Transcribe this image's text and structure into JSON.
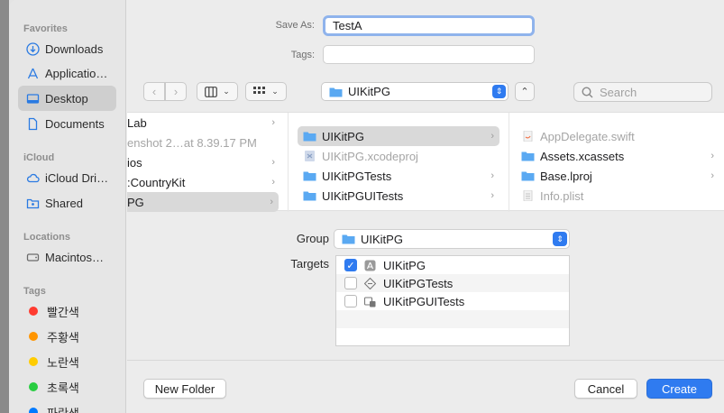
{
  "sidebar": {
    "favorites_title": "Favorites",
    "favorites": [
      {
        "label": "Downloads",
        "icon": "download-icon"
      },
      {
        "label": "Applicatio…",
        "icon": "applications-icon"
      },
      {
        "label": "Desktop",
        "icon": "desktop-icon",
        "selected": true
      },
      {
        "label": "Documents",
        "icon": "document-icon"
      }
    ],
    "icloud_title": "iCloud",
    "icloud": [
      {
        "label": "iCloud Dri…",
        "icon": "cloud-icon"
      },
      {
        "label": "Shared",
        "icon": "shared-folder-icon"
      }
    ],
    "locations_title": "Locations",
    "locations": [
      {
        "label": "Macintos…",
        "icon": "disk-icon"
      }
    ],
    "tags_title": "Tags",
    "tags": [
      {
        "label": "빨간색",
        "color": "#ff3b30"
      },
      {
        "label": "주황색",
        "color": "#ff9500"
      },
      {
        "label": "노란색",
        "color": "#ffcc00"
      },
      {
        "label": "초록색",
        "color": "#28cd41"
      },
      {
        "label": "파란색",
        "color": "#007aff"
      }
    ]
  },
  "form": {
    "save_as_label": "Save As:",
    "save_as_value": "TestA",
    "tags_label": "Tags:"
  },
  "toolbar": {
    "path": "UIKitPG",
    "search_placeholder": "Search"
  },
  "browser": {
    "col1": [
      "Lab",
      "enshot 2…at 8.39.17 PM",
      "ios",
      ":CountryKit",
      "PG"
    ],
    "col2": [
      "UIKitPG",
      "UIKitPG.xcodeproj",
      "UIKitPGTests",
      "UIKitPGUITests"
    ],
    "col3": [
      "AppDelegate.swift",
      "Assets.xcassets",
      "Base.lproj",
      "Info.plist"
    ]
  },
  "options": {
    "group_label": "Group",
    "group_value": "UIKitPG",
    "targets_label": "Targets",
    "targets": [
      {
        "label": "UIKitPG",
        "checked": true
      },
      {
        "label": "UIKitPGTests",
        "checked": false
      },
      {
        "label": "UIKitPGUITests",
        "checked": false
      }
    ]
  },
  "buttons": {
    "new_folder": "New Folder",
    "cancel": "Cancel",
    "create": "Create"
  },
  "colors": {
    "accent": "#2f7bf0"
  }
}
